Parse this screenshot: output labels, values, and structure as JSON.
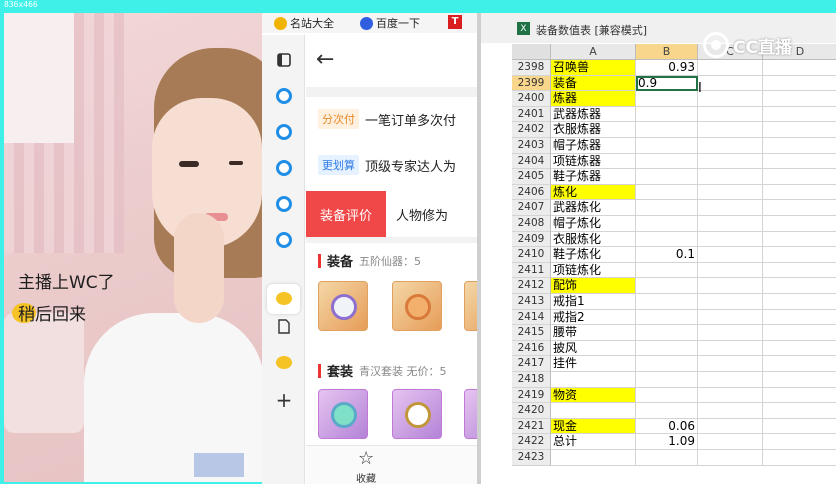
{
  "screen_label": "836x466",
  "webcam": {
    "caption_line1": "主播上WC了",
    "caption_line2": "稍后回来"
  },
  "browser": {
    "bookmarks": [
      {
        "label": "名站大全",
        "icon": "grid-star-icon",
        "color": "#f0b400"
      },
      {
        "label": "百度一下",
        "icon": "baidu-paw-icon",
        "color": "#2f5fe0"
      },
      {
        "label": "T",
        "icon": "t-red-icon",
        "color": "#d81e1e"
      }
    ],
    "rail_icons": [
      "tabs-icon",
      "browser-e-icon",
      "browser-e-icon",
      "browser-e-icon",
      "browser-e-icon",
      "browser-e-icon",
      "chick-app-icon",
      "document-icon",
      "chick-app-icon",
      "plus-icon"
    ],
    "promos": [
      {
        "tag": "分次付",
        "text": "一笔订单多次付",
        "tag_bg": "#fff0e0",
        "tag_color": "#e88a2a"
      },
      {
        "tag": "更划算",
        "text": "顶级专家达人为",
        "tag_bg": "#e6f2ff",
        "tag_color": "#2f7be6"
      }
    ],
    "tabs": [
      "装备评价",
      "人物修为"
    ],
    "sections": [
      {
        "title": "装备",
        "subtitle": "五阶仙器：5"
      },
      {
        "title": "套装",
        "subtitle": "青汉套装  无价：5"
      }
    ],
    "bottom_nav_label": "收藏"
  },
  "excel": {
    "title": "装备数值表  [兼容模式]",
    "watermark": "CC直播",
    "columns": [
      "A",
      "B",
      "C",
      "D"
    ],
    "selected_column": "B",
    "selected_row": "2399",
    "rows": [
      {
        "num": "2398",
        "a": "召唤兽",
        "b": "0.93",
        "yellow": true
      },
      {
        "num": "2399",
        "a": "装备",
        "b": "0.9",
        "yellow": true,
        "active": true
      },
      {
        "num": "2400",
        "a": "炼器",
        "b": "",
        "yellow": true
      },
      {
        "num": "2401",
        "a": "武器炼器",
        "b": ""
      },
      {
        "num": "2402",
        "a": "衣服炼器",
        "b": ""
      },
      {
        "num": "2403",
        "a": "帽子炼器",
        "b": ""
      },
      {
        "num": "2404",
        "a": "项链炼器",
        "b": ""
      },
      {
        "num": "2405",
        "a": "鞋子炼器",
        "b": ""
      },
      {
        "num": "2406",
        "a": "炼化",
        "b": "",
        "yellow": true
      },
      {
        "num": "2407",
        "a": "武器炼化",
        "b": ""
      },
      {
        "num": "2408",
        "a": "帽子炼化",
        "b": ""
      },
      {
        "num": "2409",
        "a": "衣服炼化",
        "b": ""
      },
      {
        "num": "2410",
        "a": "鞋子炼化",
        "b": "0.1"
      },
      {
        "num": "2411",
        "a": "项链炼化",
        "b": ""
      },
      {
        "num": "2412",
        "a": "配饰",
        "b": "",
        "yellow": true
      },
      {
        "num": "2413",
        "a": "戒指1",
        "b": ""
      },
      {
        "num": "2414",
        "a": "戒指2",
        "b": ""
      },
      {
        "num": "2415",
        "a": "腰带",
        "b": ""
      },
      {
        "num": "2416",
        "a": "披风",
        "b": ""
      },
      {
        "num": "2417",
        "a": "挂件",
        "b": ""
      },
      {
        "num": "2418",
        "a": "",
        "b": ""
      },
      {
        "num": "2419",
        "a": "物资",
        "b": "",
        "yellow": true
      },
      {
        "num": "2420",
        "a": "",
        "b": ""
      },
      {
        "num": "2421",
        "a": "现金",
        "b": "0.06",
        "yellow": true
      },
      {
        "num": "2422",
        "a": "总计",
        "b": "1.09"
      },
      {
        "num": "2423",
        "a": "",
        "b": ""
      }
    ]
  }
}
